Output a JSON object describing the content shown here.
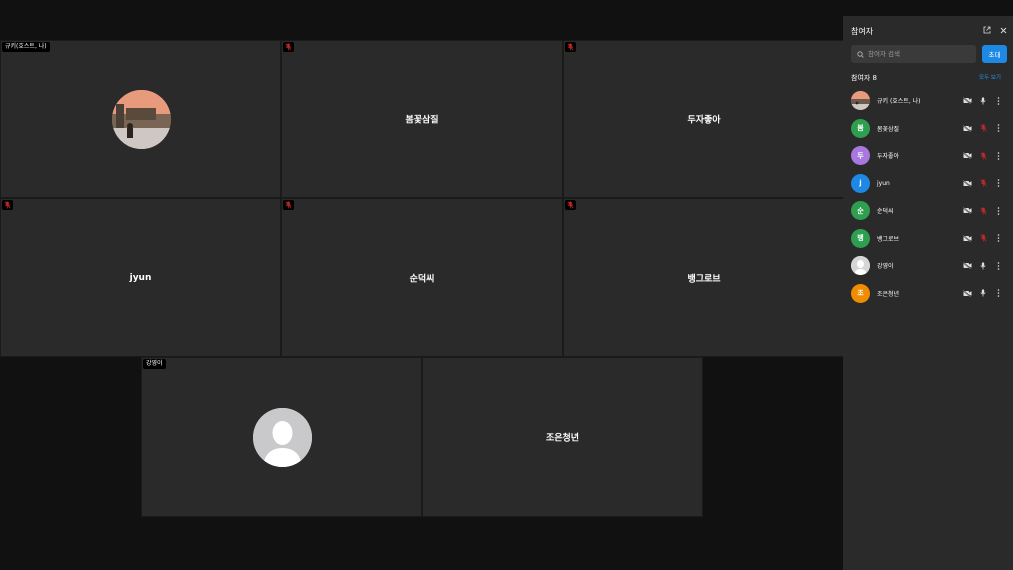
{
  "tiles": {
    "host": {
      "label": "규키(호스트, 나)"
    },
    "t2": {
      "name": "봄꽃삼질"
    },
    "t3": {
      "name": "두자좋아"
    },
    "t4": {
      "name": "jyun"
    },
    "t5": {
      "name": "순덕씨"
    },
    "t6": {
      "name": "뱅그로브"
    },
    "t7": {
      "label": "강영이"
    },
    "t8": {
      "name": "조은청년"
    }
  },
  "panel": {
    "title": "참여자",
    "search_placeholder": "참여자 검색",
    "invite_label": "초대",
    "count_label": "참여자 8",
    "view_all_label": "모두 보기"
  },
  "participants": [
    {
      "initial": "",
      "name": "규키 (호스트, 나)",
      "avatar_color": "#c97f6a",
      "mic": "on"
    },
    {
      "initial": "봄",
      "name": "봄꽃삼질",
      "avatar_color": "#2e9e4f",
      "mic": "muted"
    },
    {
      "initial": "두",
      "name": "두자좋아",
      "avatar_color": "#a877e0",
      "mic": "muted"
    },
    {
      "initial": "j",
      "name": "jyun",
      "avatar_color": "#1e88e5",
      "mic": "muted"
    },
    {
      "initial": "순",
      "name": "순덕씨",
      "avatar_color": "#2e9e4f",
      "mic": "muted"
    },
    {
      "initial": "뱅",
      "name": "뱅그로브",
      "avatar_color": "#2e9e4f",
      "mic": "muted"
    },
    {
      "initial": "",
      "name": "강영이",
      "avatar_color": "#d6d6d8",
      "mic": "on"
    },
    {
      "initial": "조",
      "name": "조은청년",
      "avatar_color": "#f08c00",
      "mic": "on"
    }
  ],
  "icons": {
    "search": "search-icon",
    "popout": "external-link-icon",
    "close": "close-icon",
    "camera_off": "camera-off-icon",
    "mic": "mic-icon",
    "mic_muted": "mic-muted-icon",
    "more": "more-vertical-icon"
  },
  "colors": {
    "accent": "#1e88e5",
    "muted_red": "#c62828",
    "tile_bg": "#2a2a2a",
    "panel_bg": "#2a2a2a"
  }
}
